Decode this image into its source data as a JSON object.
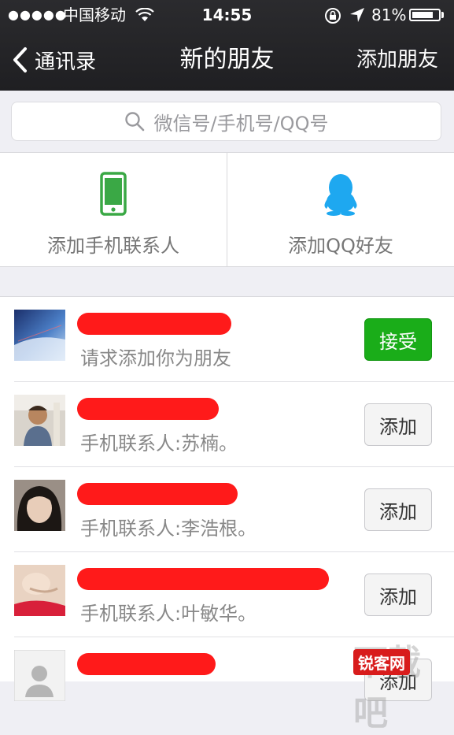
{
  "status_bar": {
    "signal": "●●●●●",
    "carrier": "中国移动",
    "time": "14:55",
    "battery": "81%",
    "battery_level": 0.81
  },
  "nav": {
    "back_label": "通讯录",
    "title": "新的朋友",
    "action_label": "添加朋友"
  },
  "search": {
    "placeholder": "微信号/手机号/QQ号"
  },
  "quick_actions": [
    {
      "label": "添加手机联系人",
      "icon": "phone-icon",
      "color": "#3aa845"
    },
    {
      "label": "添加QQ好友",
      "icon": "qq-penguin-icon",
      "color": "#1ea8f0"
    }
  ],
  "requests": [
    {
      "subtitle": "请求添加你为朋友",
      "button": "接受",
      "type": "accept"
    },
    {
      "subtitle": "手机联系人:苏楠。",
      "button": "添加",
      "type": "add"
    },
    {
      "subtitle": "手机联系人:李浩根。",
      "button": "添加",
      "type": "add"
    },
    {
      "subtitle": "手机联系人:叶敏华。",
      "button": "添加",
      "type": "add"
    },
    {
      "subtitle": "",
      "button": "添加",
      "type": "add"
    }
  ],
  "watermark": {
    "big_text": "下载吧",
    "tag_text": "锐客网"
  },
  "colors": {
    "accept_green": "#1aad19",
    "redaction_red": "#ff1a1a",
    "nav_bg": "#1f1f22"
  }
}
